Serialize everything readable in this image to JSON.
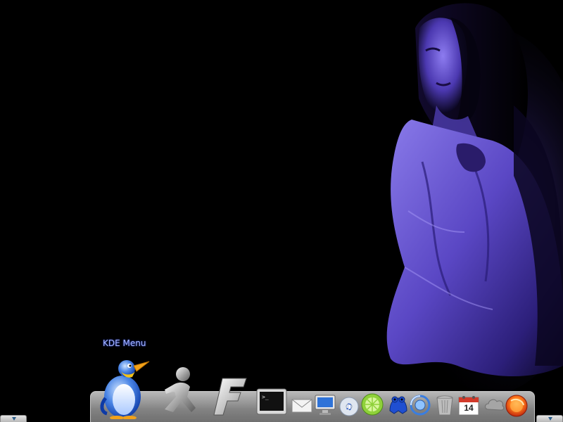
{
  "desktop": {
    "background_color": "#000000",
    "wallpaper_accent": "#6b55d8"
  },
  "dock": {
    "label": "KDE Menu",
    "label_color": "#a9b8ff",
    "items": [
      {
        "name": "kde-menu",
        "icon": "penguin-icon"
      },
      {
        "name": "aim",
        "icon": "running-man-icon"
      },
      {
        "name": "font-app",
        "icon": "f-letter-icon"
      },
      {
        "name": "terminal",
        "icon": "terminal-icon"
      },
      {
        "name": "mail",
        "icon": "envelope-icon"
      },
      {
        "name": "display",
        "icon": "monitor-icon"
      },
      {
        "name": "music",
        "icon": "music-cd-icon"
      },
      {
        "name": "limewire",
        "icon": "lime-icon"
      },
      {
        "name": "frog",
        "icon": "frog-icon"
      },
      {
        "name": "network",
        "icon": "network-ring-icon"
      },
      {
        "name": "trash",
        "icon": "trash-icon"
      },
      {
        "name": "calendar",
        "icon": "calendar-icon"
      },
      {
        "name": "weather",
        "icon": "cloud-icon"
      },
      {
        "name": "firefox",
        "icon": "firefox-icon"
      }
    ],
    "calendar_day": "14"
  }
}
